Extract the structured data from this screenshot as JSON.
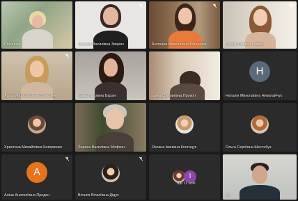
{
  "participants": [
    {
      "name": "Світлана",
      "type": "video"
    },
    {
      "name": "Наталія Василівна Зварич",
      "type": "video"
    },
    {
      "name": "Антоніна Миколаївна Богданюк",
      "type": "video"
    },
    {
      "name": "Ольга Юріївна Коваль",
      "type": "video"
    },
    {
      "name": "Алла Мирославівна Григорчук",
      "type": "video"
    },
    {
      "name": "Ірина Петрівна Баран",
      "type": "video"
    },
    {
      "name": "Ірина Степанівна Прокоп",
      "type": "video"
    },
    {
      "name": "Наталія Миколаївна Николайчук",
      "type": "letter",
      "letter": "H",
      "color": "#5a6a78"
    },
    {
      "name": "Христина Михайлівна Катеринюк",
      "type": "photo"
    },
    {
      "name": "Лариса Василівна Мофтин",
      "type": "video"
    },
    {
      "name": "Оксана Іванівна Костицук",
      "type": "photo"
    },
    {
      "name": "Ольга Сергіївна Шестобуз",
      "type": "photo"
    },
    {
      "name": "Аліна Анатоліївна Предин",
      "type": "letter",
      "letter": "A",
      "color": "#e8731a"
    },
    {
      "name": "Віталія Віталіївна Дідух",
      "type": "photo"
    },
    {
      "name": "Ще 11 осіб",
      "type": "more",
      "letter": "I",
      "color": "#8e44ad"
    },
    {
      "name": "Ви",
      "type": "video"
    }
  ],
  "colors": {
    "active_border": "#4a90e2",
    "tile_bg": "#2b2b2b",
    "page_bg": "#1a1a1a"
  }
}
